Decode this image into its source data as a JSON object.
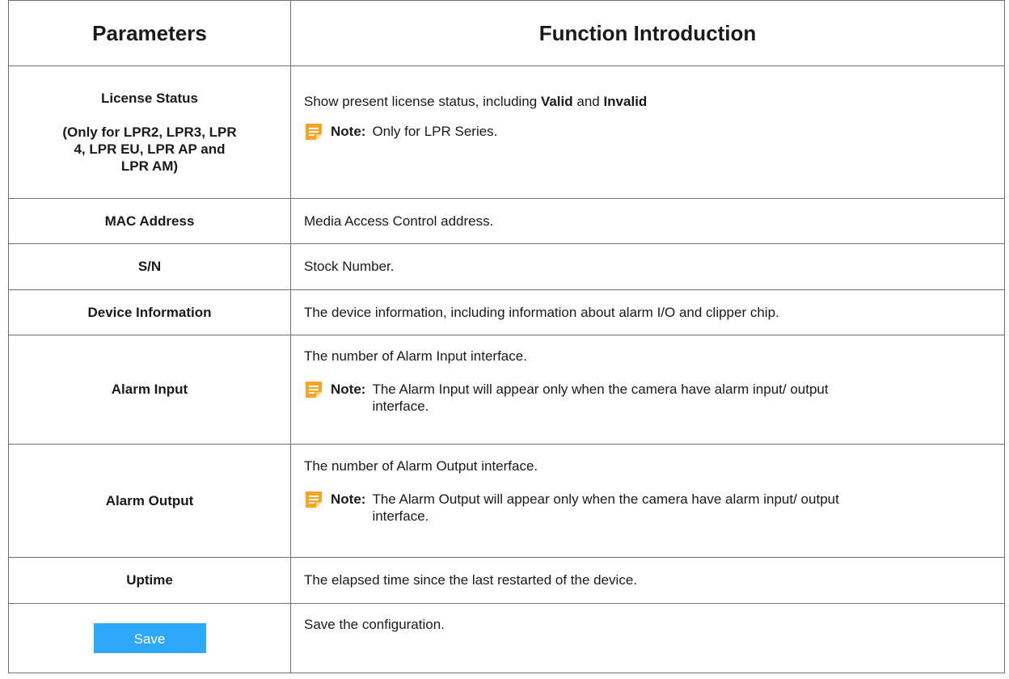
{
  "header": {
    "col1": "Parameters",
    "col2": "Function Introduction"
  },
  "rows": {
    "license": {
      "param_title": "License Status",
      "param_sub": "(Only for LPR2, LPR3, LPR 4, LPR EU, LPR AP and LPR AM)",
      "desc_pre": "Show present license status, including ",
      "desc_valid": "Valid",
      "desc_and": " and ",
      "desc_invalid": "Invalid",
      "note_label": "Note:",
      "note_text": "Only for LPR Series."
    },
    "mac": {
      "param": "MAC Address",
      "desc": "Media Access Control address."
    },
    "sn": {
      "param": "S/N",
      "desc": "Stock Number."
    },
    "device_info": {
      "param": "Device Information",
      "desc": "The device information, including information about alarm I/O and clipper chip."
    },
    "alarm_input": {
      "param": "Alarm Input",
      "desc": "The number of Alarm Input interface.",
      "note_label": "Note:",
      "note_text": "The Alarm Input will appear only when the camera have alarm input/ output interface."
    },
    "alarm_output": {
      "param": "Alarm Output",
      "desc": "The number of Alarm Output interface.",
      "note_label": "Note:",
      "note_text": "The Alarm Output will appear only when the camera have alarm input/ output interface."
    },
    "uptime": {
      "param": "Uptime",
      "desc": "The elapsed time since the last restarted of the device."
    },
    "save": {
      "button_label": "Save",
      "desc": "Save the configuration."
    }
  },
  "colors": {
    "note_icon": "#f5a623",
    "save_button": "#2ea8f8",
    "border": "#6f6f6f"
  },
  "icons": {
    "note": "note-icon"
  }
}
